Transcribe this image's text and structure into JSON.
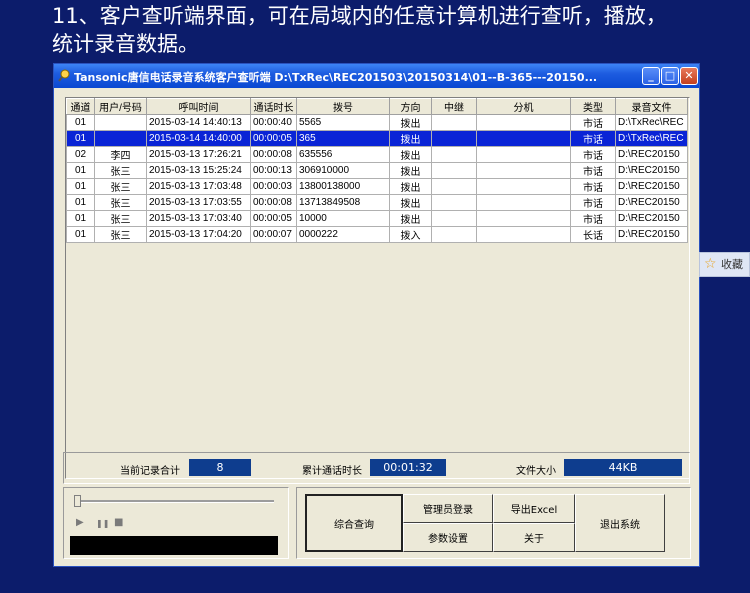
{
  "heading": {
    "line1": "11、客户查听端界面，可在局域内的任意计算机进行查听，播放，",
    "line2": "统计录音数据。"
  },
  "window": {
    "title": "Tansonic唐信电话录音系统客户查听端  D:\\TxRec\\REC201503\\20150314\\01--B-365---20150...",
    "minimize_icon": "minimize-icon",
    "maximize_icon": "maximize-icon",
    "close_icon": "close-icon"
  },
  "table": {
    "headers": [
      "通道",
      "用户/号码",
      "呼叫时间",
      "通话时长",
      "拨号",
      "方向",
      "中继",
      "分机",
      "类型",
      "录音文件"
    ],
    "rows": [
      [
        "01",
        "",
        "2015-03-14 14:40:13",
        "00:00:40",
        "5565",
        "拨出",
        "",
        "",
        "市话",
        "D:\\TxRec\\REC"
      ],
      [
        "01",
        "",
        "2015-03-14 14:40:00",
        "00:00:05",
        "365",
        "拨出",
        "",
        "",
        "市话",
        "D:\\TxRec\\REC"
      ],
      [
        "02",
        "李四",
        "2015-03-13 17:26:21",
        "00:00:08",
        "635556",
        "拨出",
        "",
        "",
        "市话",
        "D:\\REC20150"
      ],
      [
        "01",
        "张三",
        "2015-03-13 15:25:24",
        "00:00:13",
        "306910000",
        "拨出",
        "",
        "",
        "市话",
        "D:\\REC20150"
      ],
      [
        "01",
        "张三",
        "2015-03-13 17:03:48",
        "00:00:03",
        "13800138000",
        "拨出",
        "",
        "",
        "市话",
        "D:\\REC20150"
      ],
      [
        "01",
        "张三",
        "2015-03-13 17:03:55",
        "00:00:08",
        "13713849508",
        "拨出",
        "",
        "",
        "市话",
        "D:\\REC20150"
      ],
      [
        "01",
        "张三",
        "2015-03-13 17:03:40",
        "00:00:05",
        "10000",
        "拨出",
        "",
        "",
        "市话",
        "D:\\REC20150"
      ],
      [
        "01",
        "张三",
        "2015-03-13 17:04:20",
        "00:00:07",
        "0000222",
        "拨入",
        "",
        "",
        "长话",
        "D:\\REC20150"
      ]
    ],
    "selected_row": 1
  },
  "stats": {
    "record_count_label": "当前记录合计",
    "record_count": "8",
    "total_duration_label": "累计通话时长",
    "total_duration": "00:01:32",
    "file_size_label": "文件大小",
    "file_size": "44KB"
  },
  "player": {
    "play_icon": "play-icon",
    "pause_icon": "pause-icon",
    "stop_icon": "stop-icon",
    "play_glyph": "▶",
    "pause_glyph": "❚❚",
    "stop_glyph": "■",
    "progress": 0
  },
  "buttons": {
    "query": "综合查询",
    "admin_login": "管理员登录",
    "export_excel": "导出Excel",
    "param_settings": "参数设置",
    "about": "关于",
    "exit": "退出系统"
  },
  "favorite": {
    "icon": "star-icon",
    "label": "收藏"
  }
}
